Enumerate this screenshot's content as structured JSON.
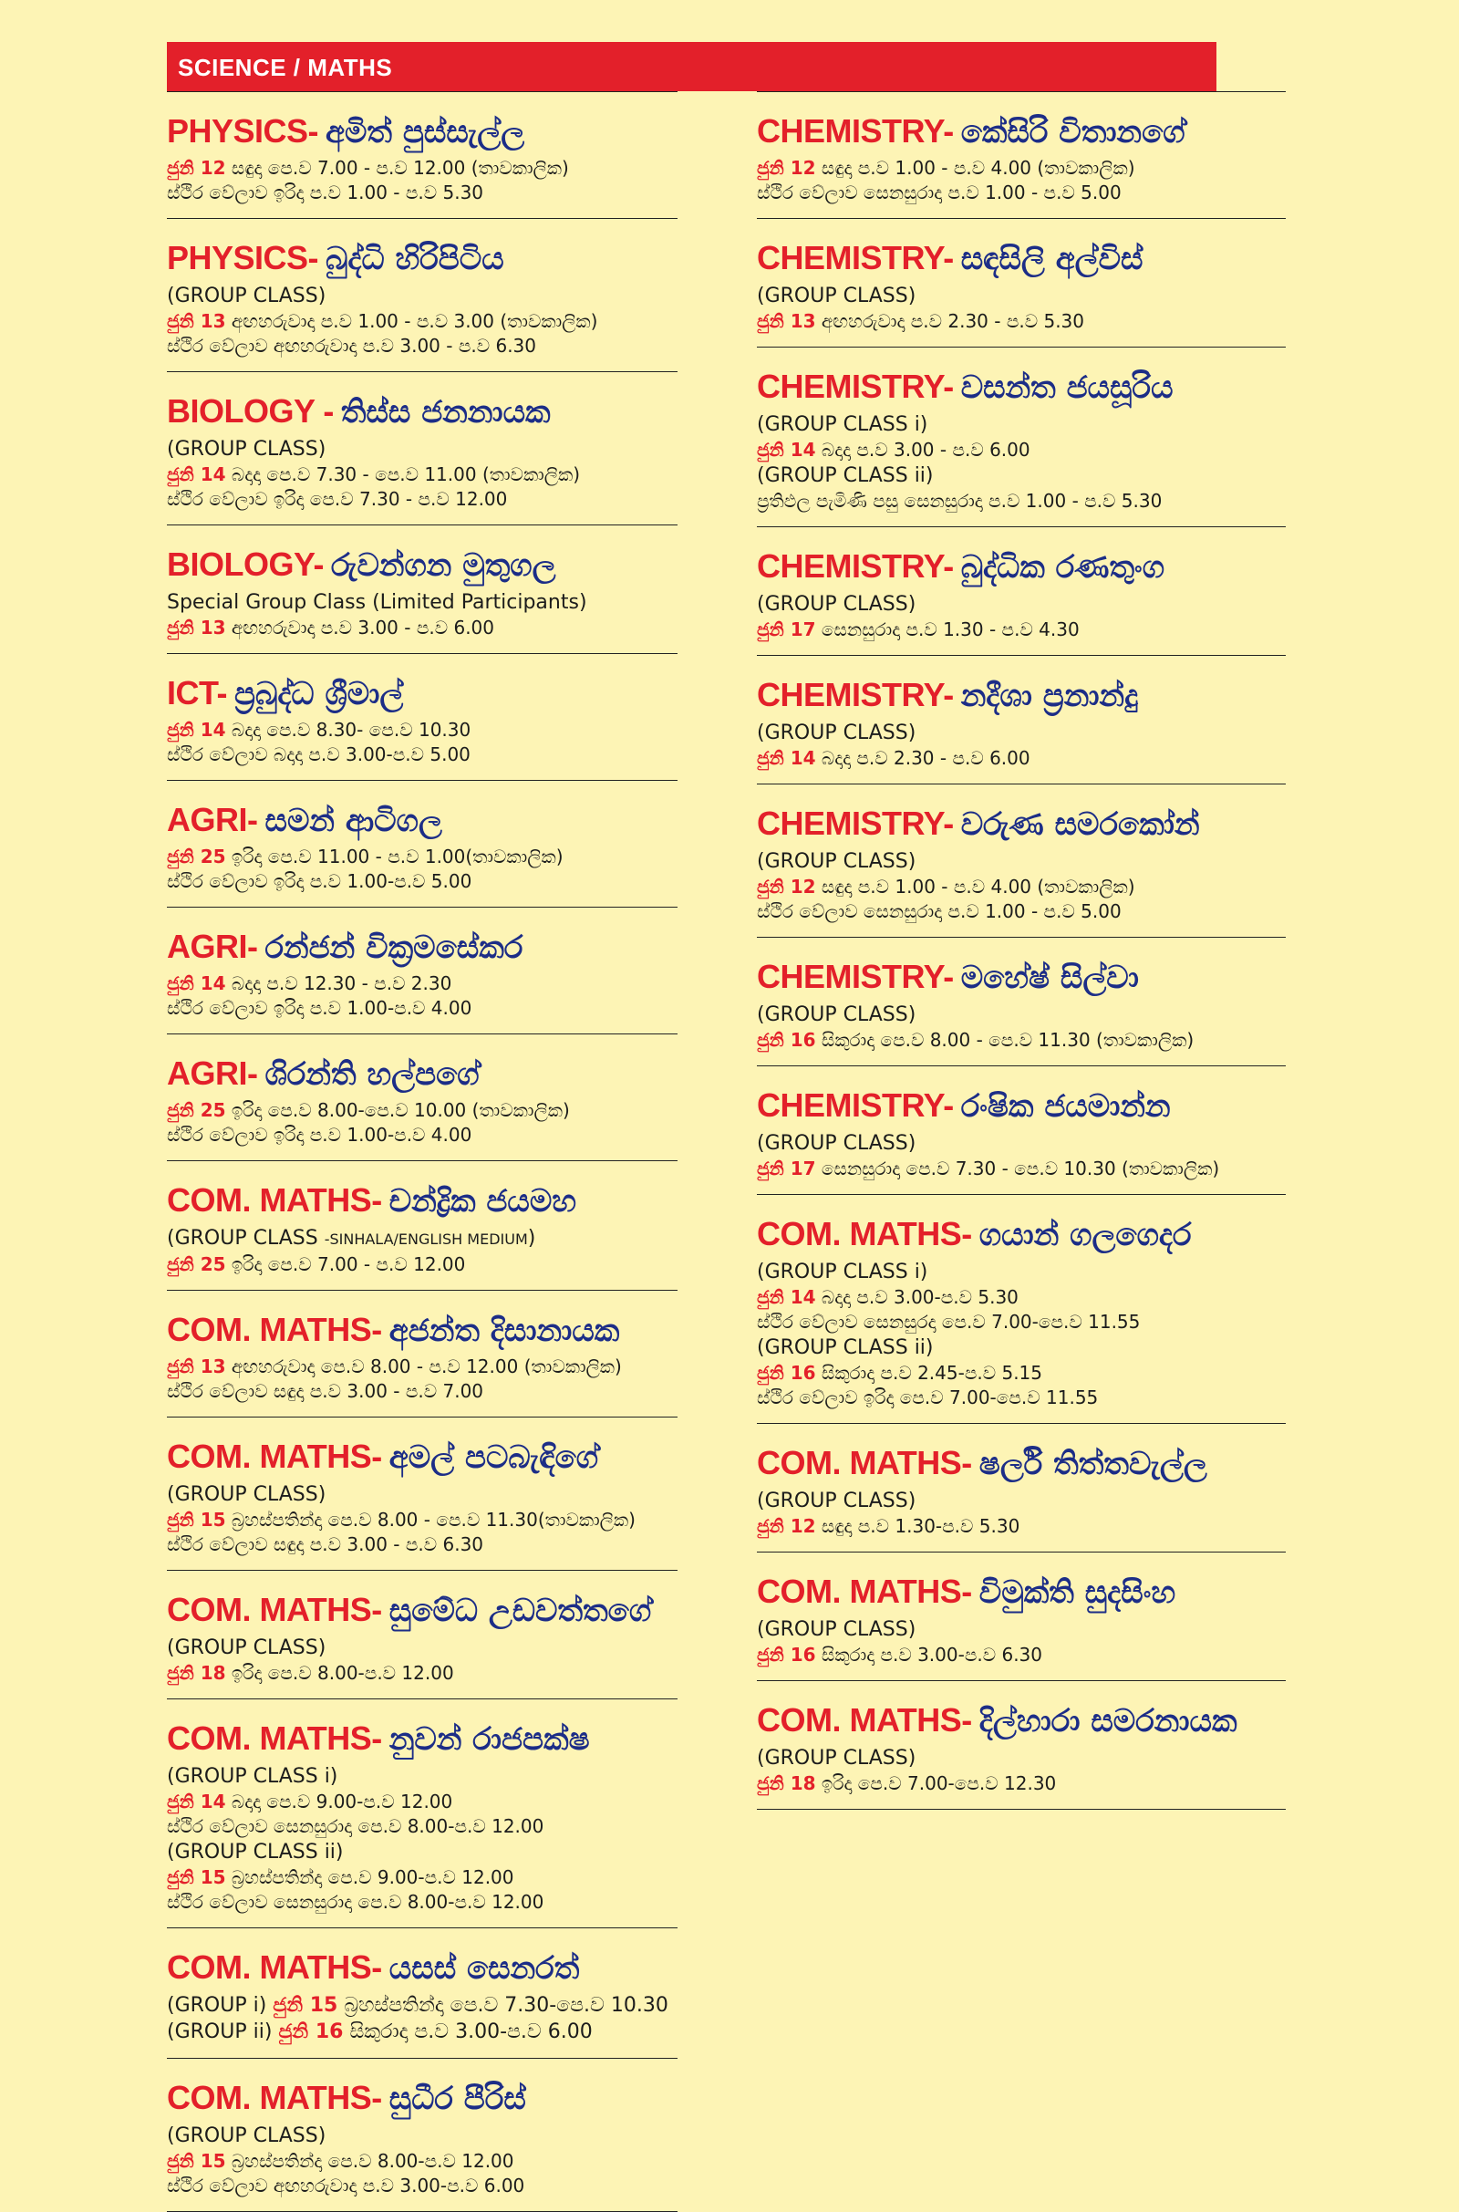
{
  "header": {
    "title": "SCIENCE / MATHS"
  },
  "left": [
    {
      "subject": "PHYSICS-",
      "teacher": "අමිත් පුස්සැල්ල",
      "lines": [
        [
          {
            "t": "ජුනි 12",
            "c": "date"
          },
          {
            "t": " සඳුදා පෙ.ව 7.00 - ප.ව 12.00 (තාවකාලික)"
          }
        ],
        [
          {
            "t": "ස්ථිර වේලාව ඉරිදා ප.ව 1.00 - ප.ව 5.30"
          }
        ]
      ]
    },
    {
      "subject": "PHYSICS-",
      "teacher": "බුද්ධි හිරිපිටිය",
      "lines": [
        [
          {
            "t": "(GROUP CLASS)",
            "c": "label"
          }
        ],
        [
          {
            "t": "ජුනි 13",
            "c": "date"
          },
          {
            "t": " අඟහරුවාදා ප.ව 1.00 - ප.ව 3.00 (තාවකාලික)"
          }
        ],
        [
          {
            "t": "ස්ථිර වේලාව අඟහරුවාදා ප.ව 3.00 - ප.ව 6.30"
          }
        ]
      ]
    },
    {
      "subject": "BIOLOGY -",
      "teacher": "තිස්ස ජනනායක",
      "lines": [
        [
          {
            "t": "(GROUP CLASS)",
            "c": "label"
          }
        ],
        [
          {
            "t": "ජුනි 14",
            "c": "date"
          },
          {
            "t": " බදාදා පෙ.ව 7.30 - පෙ.ව 11.00 (තාවකාලික)"
          }
        ],
        [
          {
            "t": "ස්ථිර වේලාව ඉරිදා පෙ.ව 7.30 - ප.ව 12.00"
          }
        ]
      ]
    },
    {
      "subject": "BIOLOGY-",
      "teacher": "රුවන්ගන මුතුගල",
      "lines": [
        [
          {
            "t": "Special Group Class (Limited Participants)",
            "c": "label"
          }
        ],
        [
          {
            "t": "ජුනි 13",
            "c": "date"
          },
          {
            "t": " අඟහරුවාදා ප.ව 3.00 - ප.ව 6.00"
          }
        ]
      ]
    },
    {
      "subject": "ICT-",
      "teacher": "ප්‍රබුද්ධ ශ්‍රීමාල්",
      "lines": [
        [
          {
            "t": "ජුනි 14",
            "c": "date"
          },
          {
            "t": " බදාදා පෙ.ව 8.30- පෙ.ව 10.30"
          }
        ],
        [
          {
            "t": "ස්ථිර වේලාව බදාදා ප.ව 3.00-ප.ව 5.00"
          }
        ]
      ]
    },
    {
      "subject": "AGRI-",
      "teacher": "සමන් ආටිගල",
      "lines": [
        [
          {
            "t": "ජුනි 25",
            "c": "date"
          },
          {
            "t": " ඉරිදා පෙ.ව 11.00 - ප.ව 1.00(තාවකාලික)"
          }
        ],
        [
          {
            "t": "ස්ථිර වේලාව ඉරිදා ප.ව 1.00-ප.ව 5.00"
          }
        ]
      ]
    },
    {
      "subject": "AGRI-",
      "teacher": "රන්ජන් වික්‍රමසේකර",
      "lines": [
        [
          {
            "t": "ජුනි 14",
            "c": "date"
          },
          {
            "t": " බදාදා ප.ව 12.30 - ප.ව 2.30"
          }
        ],
        [
          {
            "t": "ස්ථිර වේලාව ඉරිදා ප.ව 1.00-ප.ව 4.00"
          }
        ]
      ]
    },
    {
      "subject": "AGRI-",
      "teacher": "ශිරන්ති හල්පගේ",
      "lines": [
        [
          {
            "t": "ජුනි 25",
            "c": "date"
          },
          {
            "t": " ඉරිදා පෙ.ව 8.00-පෙ.ව 10.00 (තාවකාලික)"
          }
        ],
        [
          {
            "t": "ස්ථිර වේලාව ඉරිදා ප.ව 1.00-ප.ව 4.00"
          }
        ]
      ]
    },
    {
      "subject": "COM. MATHS-",
      "teacher": "චන්ද්‍රික ජයමහ",
      "lines": [
        [
          {
            "t": "(GROUP CLASS ",
            "c": "label"
          },
          {
            "t": "-SINHALA/ENGLISH MEDIUM",
            "c": "small"
          },
          {
            "t": ")",
            "c": "label"
          }
        ],
        [
          {
            "t": "ජුනි 25",
            "c": "date"
          },
          {
            "t": " ඉරිදා පෙ.ව 7.00 - ප.ව 12.00"
          }
        ]
      ]
    },
    {
      "subject": "COM. MATHS-",
      "teacher": "අජන්ත දිසානායක",
      "lines": [
        [
          {
            "t": "ජුනි 13",
            "c": "date"
          },
          {
            "t": " අඟහරුවාදා පෙ.ව 8.00 - ප.ව 12.00 (තාවකාලික)"
          }
        ],
        [
          {
            "t": "ස්ථිර වේලාව සඳුදා ප.ව 3.00 - ප.ව 7.00"
          }
        ]
      ]
    },
    {
      "subject": "COM. MATHS-",
      "teacher": "අමල් පටබැඳිගේ",
      "lines": [
        [
          {
            "t": "(GROUP CLASS)",
            "c": "label"
          }
        ],
        [
          {
            "t": "ජුනි 15",
            "c": "date"
          },
          {
            "t": " බ්‍රහස්පතින්දා පෙ.ව 8.00 - පෙ.ව 11.30(තාවකාලික)"
          }
        ],
        [
          {
            "t": "ස්ථිර වේලාව සඳුදා ප.ව 3.00 - ප.ව 6.30"
          }
        ]
      ]
    },
    {
      "subject": "COM. MATHS-",
      "teacher": "සුමේධ උඩවත්තගේ",
      "lines": [
        [
          {
            "t": "(GROUP CLASS)",
            "c": "label"
          }
        ],
        [
          {
            "t": "ජුනි 18",
            "c": "date"
          },
          {
            "t": " ඉරිදා පෙ.ව 8.00-ප.ව 12.00"
          }
        ]
      ]
    },
    {
      "subject": "COM. MATHS-",
      "teacher": "නුවන් රාජපක්ෂ",
      "lines": [
        [
          {
            "t": "(GROUP CLASS i)",
            "c": "label"
          }
        ],
        [
          {
            "t": "ජුනි 14",
            "c": "date"
          },
          {
            "t": " බදාදා පෙ.ව 9.00-ප.ව 12.00"
          }
        ],
        [
          {
            "t": "ස්ථිර වේලාව සෙනසුරාදා පෙ.ව 8.00-ප.ව 12.00"
          }
        ],
        [
          {
            "t": "(GROUP CLASS ii)",
            "c": "label"
          }
        ],
        [
          {
            "t": "ජුනි 15",
            "c": "date"
          },
          {
            "t": " බ්‍රහස්පතින්දා පෙ.ව 9.00-ප.ව 12.00"
          }
        ],
        [
          {
            "t": "ස්ථිර වේලාව සෙනසුරාදා පෙ.ව 8.00-ප.ව 12.00"
          }
        ]
      ]
    },
    {
      "subject": "COM. MATHS-",
      "teacher": "යසස් සෙනරත්",
      "lines": [
        [
          {
            "t": "(GROUP i) ",
            "c": "label"
          },
          {
            "t": "ජුනි 15",
            "c": "date"
          },
          {
            "t": " බ්‍රහස්පතින්දා පෙ.ව 7.30-පෙ.ව 10.30"
          }
        ],
        [
          {
            "t": "(GROUP ii) ",
            "c": "label"
          },
          {
            "t": "ජුනි 16",
            "c": "date"
          },
          {
            "t": " සිකුරාදා ප.ව 3.00-ප.ව 6.00"
          }
        ]
      ]
    },
    {
      "subject": "COM. MATHS-",
      "teacher": "සුධීර පීරිස්",
      "lines": [
        [
          {
            "t": "(GROUP CLASS)",
            "c": "label"
          }
        ],
        [
          {
            "t": "ජුනි 15",
            "c": "date"
          },
          {
            "t": " බ්‍රහස්පතින්දා පෙ.ව 8.00-ප.ව 12.00"
          }
        ],
        [
          {
            "t": "ස්ථිර වේලාව අඟහරුවාදා ප.ව 3.00-ප.ව 6.00"
          }
        ]
      ]
    }
  ],
  "right": [
    {
      "subject": "CHEMISTRY-",
      "teacher": "කේසිරි විතානගේ",
      "lines": [
        [
          {
            "t": "ජුනි 12",
            "c": "date"
          },
          {
            "t": " සඳුදා ප.ව 1.00 - ප.ව 4.00 (තාවකාලික)"
          }
        ],
        [
          {
            "t": "ස්ථිර වේලාව සෙනසුරාදා ප.ව 1.00 - ප.ව 5.00"
          }
        ]
      ]
    },
    {
      "subject": "CHEMISTRY-",
      "teacher": "සඳසිලි අල්විස්",
      "lines": [
        [
          {
            "t": "(GROUP CLASS)",
            "c": "label"
          }
        ],
        [
          {
            "t": "ජුනි 13",
            "c": "date"
          },
          {
            "t": " අඟහරුවාදා ප.ව 2.30 - ප.ව 5.30"
          }
        ]
      ]
    },
    {
      "subject": "CHEMISTRY-",
      "teacher": "වසන්ත ජයසූරිය",
      "lines": [
        [
          {
            "t": "(GROUP CLASS i)",
            "c": "label"
          }
        ],
        [
          {
            "t": "ජුනි 14",
            "c": "date"
          },
          {
            "t": " බදාදා ප.ව 3.00 - ප.ව 6.00"
          }
        ],
        [
          {
            "t": "(GROUP CLASS ii)",
            "c": "label"
          }
        ],
        [
          {
            "t": "ප්‍රතිඵල පැමිණි පසු සෙනසුරාදා ප.ව 1.00 - ප.ව 5.30"
          }
        ]
      ]
    },
    {
      "subject": "CHEMISTRY-",
      "teacher": "බුද්ධික රණතුංග",
      "lines": [
        [
          {
            "t": "(GROUP CLASS)",
            "c": "label"
          }
        ],
        [
          {
            "t": "ජුනි 17",
            "c": "date"
          },
          {
            "t": " සෙනසුරාදා ප.ව 1.30 - ප.ව 4.30"
          }
        ]
      ]
    },
    {
      "subject": "CHEMISTRY-",
      "teacher": "නදීශා ප්‍රනාන්දු",
      "lines": [
        [
          {
            "t": "(GROUP CLASS)",
            "c": "label"
          }
        ],
        [
          {
            "t": "ජුනි 14",
            "c": "date"
          },
          {
            "t": " බදාදා ප.ව 2.30 - ප.ව 6.00"
          }
        ]
      ]
    },
    {
      "subject": "CHEMISTRY-",
      "teacher": "වරුණ සමරකෝන්",
      "lines": [
        [
          {
            "t": "(GROUP CLASS)",
            "c": "label"
          }
        ],
        [
          {
            "t": "ජුනි 12",
            "c": "date"
          },
          {
            "t": " සඳුදා ප.ව 1.00 - ප.ව 4.00 (තාවකාලික)"
          }
        ],
        [
          {
            "t": "ස්ථිර වේලාව සෙනසුරාදා ප.ව 1.00 - ප.ව 5.00"
          }
        ]
      ]
    },
    {
      "subject": "CHEMISTRY-",
      "teacher": "මහේෂ් සිල්වා",
      "lines": [
        [
          {
            "t": "(GROUP CLASS)",
            "c": "label"
          }
        ],
        [
          {
            "t": "ජුනි 16",
            "c": "date"
          },
          {
            "t": " සිකුරාදා පෙ.ව 8.00 - පෙ.ව 11.30 (තාවකාලික)"
          }
        ]
      ]
    },
    {
      "subject": "CHEMISTRY-",
      "teacher": "රංෂික ජයමාන්න",
      "lines": [
        [
          {
            "t": "(GROUP CLASS)",
            "c": "label"
          }
        ],
        [
          {
            "t": "ජුනි 17",
            "c": "date"
          },
          {
            "t": " සෙනසුරාදා පෙ.ව 7.30 - පෙ.ව 10.30 (තාවකාලික)"
          }
        ]
      ]
    },
    {
      "subject": "COM. MATHS-",
      "teacher": "ගයාන් ගලගෙදර",
      "lines": [
        [
          {
            "t": "(GROUP CLASS i)",
            "c": "label"
          }
        ],
        [
          {
            "t": "ජුනි 14",
            "c": "date"
          },
          {
            "t": " බදාදා ප.ව 3.00-ප.ව 5.30"
          }
        ],
        [
          {
            "t": "ස්ථිර වේලාව සෙනසුරදා පෙ.ව 7.00-පෙ.ව 11.55"
          }
        ],
        [
          {
            "t": "(GROUP CLASS ii)",
            "c": "label"
          }
        ],
        [
          {
            "t": "ජුනි 16",
            "c": "date"
          },
          {
            "t": " සිකුරාදා ප.ව 2.45-ප.ව 5.15"
          }
        ],
        [
          {
            "t": "ස්ථිර වේලාව ඉරිදා පෙ.ව 7.00-පෙ.ව 11.55"
          }
        ]
      ]
    },
    {
      "subject": "COM. MATHS-",
      "teacher": "ෂර්ලි තිත්තවැල්ල",
      "lines": [
        [
          {
            "t": "(GROUP CLASS)",
            "c": "label"
          }
        ],
        [
          {
            "t": "ජුනි 12",
            "c": "date"
          },
          {
            "t": " සඳුදා ප.ව 1.30-ප.ව 5.30"
          }
        ]
      ]
    },
    {
      "subject": "COM. MATHS-",
      "teacher": "විමුක්ති සුදසිංහ",
      "lines": [
        [
          {
            "t": "(GROUP CLASS)",
            "c": "label"
          }
        ],
        [
          {
            "t": "ජුනි 16",
            "c": "date"
          },
          {
            "t": " සිකුරාදා ප.ව 3.00-ප.ව 6.30"
          }
        ]
      ]
    },
    {
      "subject": "COM. MATHS-",
      "teacher": "දිල්හාරා සමරනායක",
      "lines": [
        [
          {
            "t": "(GROUP CLASS)",
            "c": "label"
          }
        ],
        [
          {
            "t": "ජුනි 18",
            "c": "date"
          },
          {
            "t": " ඉරිදා පෙ.ව 7.00-පෙ.ව 12.30"
          }
        ]
      ]
    }
  ]
}
